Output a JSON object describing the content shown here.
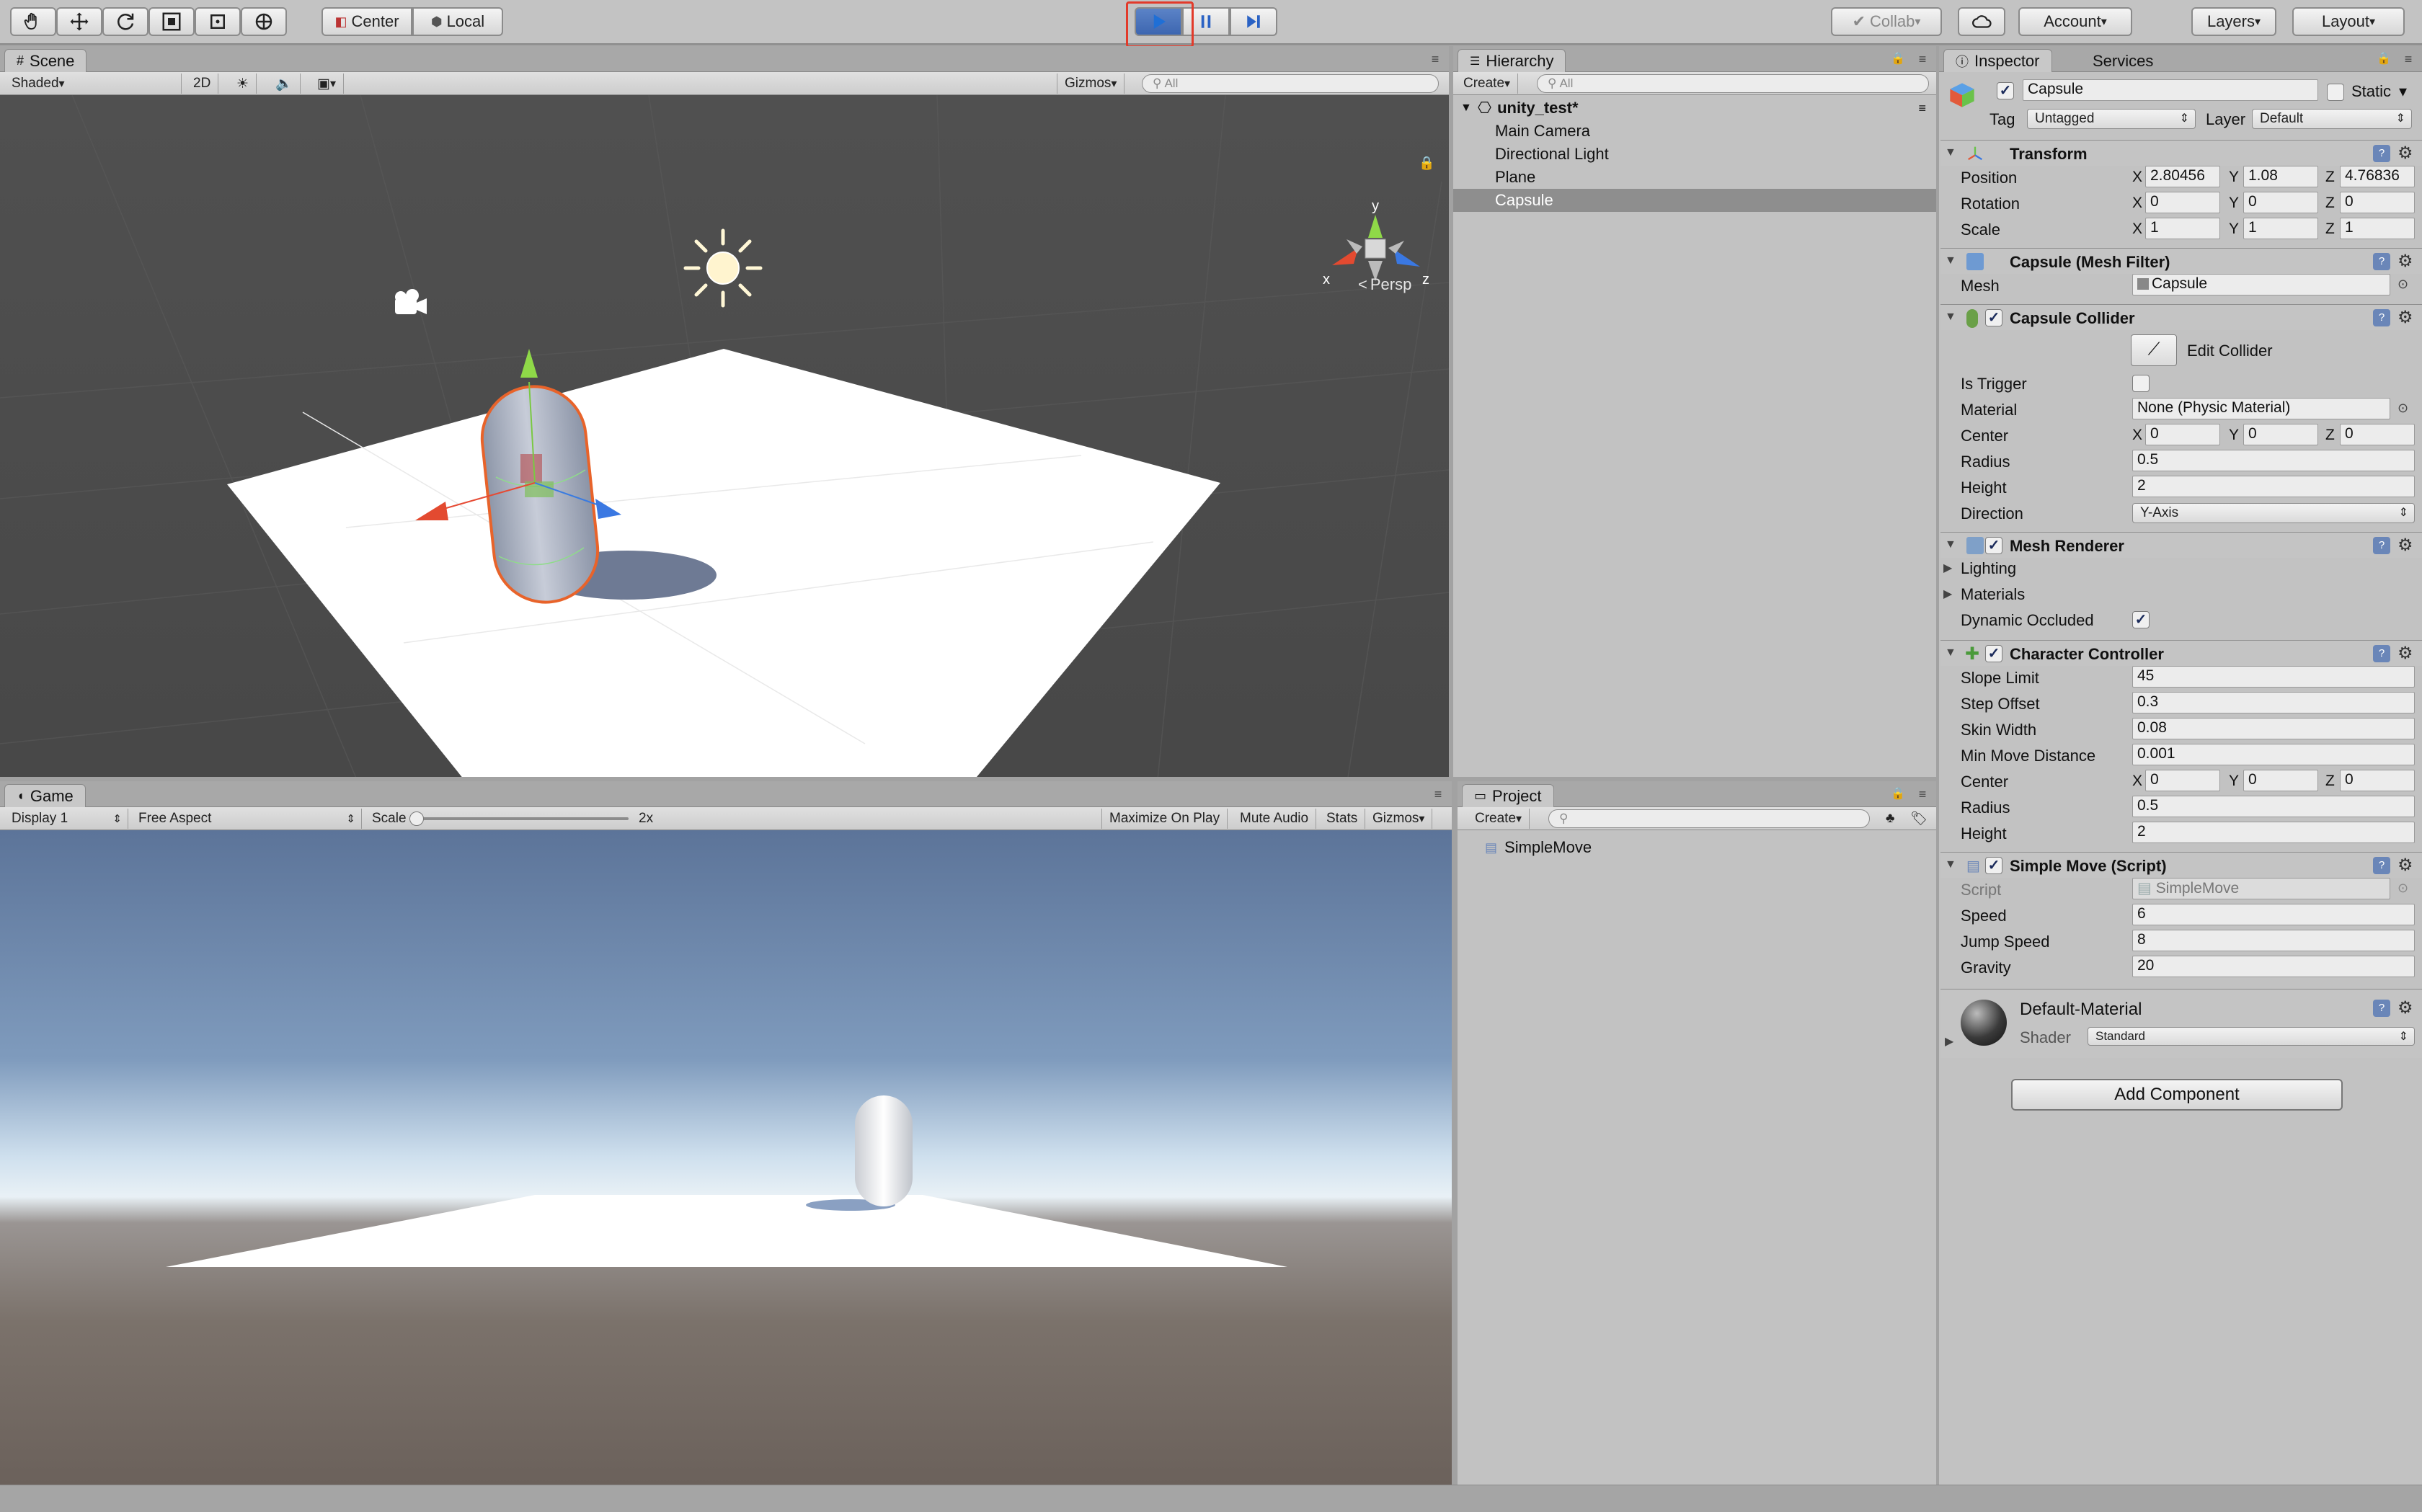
{
  "toolbar": {
    "pivot_label": "Center",
    "space_label": "Local",
    "collab_label": "Collab",
    "account_label": "Account",
    "layers_label": "Layers",
    "layout_label": "Layout"
  },
  "scene": {
    "tab_label": "Scene",
    "shading_mode": "Shaded",
    "mode_2d": "2D",
    "gizmos_label": "Gizmos",
    "search_placeholder": "All",
    "persp_label": "Persp",
    "axis_x": "x",
    "axis_y": "y",
    "axis_z": "z"
  },
  "game": {
    "tab_label": "Game",
    "display": "Display 1",
    "aspect": "Free Aspect",
    "scale_label": "Scale",
    "scale_value": "2x",
    "maximize_label": "Maximize On Play",
    "mute_label": "Mute Audio",
    "stats_label": "Stats",
    "gizmos_label": "Gizmos"
  },
  "hierarchy": {
    "tab_label": "Hierarchy",
    "create_label": "Create",
    "search_placeholder": "All",
    "scene_name": "unity_test*",
    "items": [
      "Main Camera",
      "Directional Light",
      "Plane",
      "Capsule"
    ],
    "selected_index": 3
  },
  "project": {
    "tab_label": "Project",
    "create_label": "Create",
    "items": [
      "SimpleMove"
    ]
  },
  "inspector": {
    "tab_label": "Inspector",
    "services_tab": "Services",
    "object_name": "Capsule",
    "static_label": "Static",
    "tag_label": "Tag",
    "tag_value": "Untagged",
    "layer_label": "Layer",
    "layer_value": "Default",
    "transform": {
      "title": "Transform",
      "position_label": "Position",
      "rotation_label": "Rotation",
      "scale_label": "Scale",
      "position": [
        "2.80456",
        "1.08",
        "4.76836"
      ],
      "rotation": [
        "0",
        "0",
        "0"
      ],
      "scale": [
        "1",
        "1",
        "1"
      ]
    },
    "mesh_filter": {
      "title": "Capsule (Mesh Filter)",
      "mesh_label": "Mesh",
      "mesh_value": "Capsule"
    },
    "capsule_collider": {
      "title": "Capsule Collider",
      "edit_label": "Edit Collider",
      "is_trigger_label": "Is Trigger",
      "material_label": "Material",
      "material_value": "None (Physic Material)",
      "center_label": "Center",
      "center": [
        "0",
        "0",
        "0"
      ],
      "radius_label": "Radius",
      "radius": "0.5",
      "height_label": "Height",
      "height": "2",
      "direction_label": "Direction",
      "direction": "Y-Axis"
    },
    "mesh_renderer": {
      "title": "Mesh Renderer",
      "lighting_label": "Lighting",
      "materials_label": "Materials",
      "dynamic_occluded_label": "Dynamic Occluded"
    },
    "character_controller": {
      "title": "Character Controller",
      "slope_limit_label": "Slope Limit",
      "slope_limit": "45",
      "step_offset_label": "Step Offset",
      "step_offset": "0.3",
      "skin_width_label": "Skin Width",
      "skin_width": "0.08",
      "min_move_label": "Min Move Distance",
      "min_move": "0.001",
      "center_label": "Center",
      "center": [
        "0",
        "0",
        "0"
      ],
      "radius_label": "Radius",
      "radius": "0.5",
      "height_label": "Height",
      "height": "2"
    },
    "simple_move": {
      "title": "Simple Move (Script)",
      "script_label": "Script",
      "script_value": "SimpleMove",
      "speed_label": "Speed",
      "speed": "6",
      "jump_label": "Jump Speed",
      "jump": "8",
      "gravity_label": "Gravity",
      "gravity": "20"
    },
    "material": {
      "name": "Default-Material",
      "shader_label": "Shader",
      "shader_value": "Standard"
    },
    "add_component_label": "Add Component"
  }
}
